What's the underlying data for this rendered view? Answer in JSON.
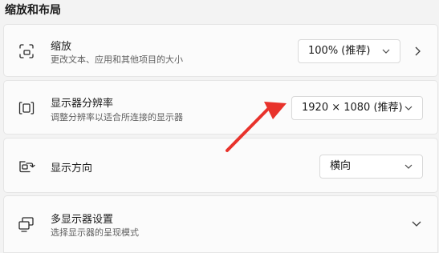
{
  "section": {
    "title": "缩放和布局"
  },
  "rows": [
    {
      "title": "缩放",
      "subtitle": "更改文本、应用和其他项目的大小",
      "icon": "scale-icon",
      "dropdown_value": "100% (推荐)",
      "has_arrow": true
    },
    {
      "title": "显示器分辨率",
      "subtitle": "调整分辨率以适合所连接的显示器",
      "icon": "resolution-icon",
      "dropdown_value": "1920 × 1080 (推荐)"
    },
    {
      "title": "显示方向",
      "icon": "orientation-icon",
      "dropdown_value": "横向"
    },
    {
      "title": "多显示器设置",
      "subtitle": "选择显示器的呈现模式",
      "icon": "multi-display-icon",
      "expandable": true
    }
  ],
  "annotation": {
    "color": "#e8322b"
  }
}
